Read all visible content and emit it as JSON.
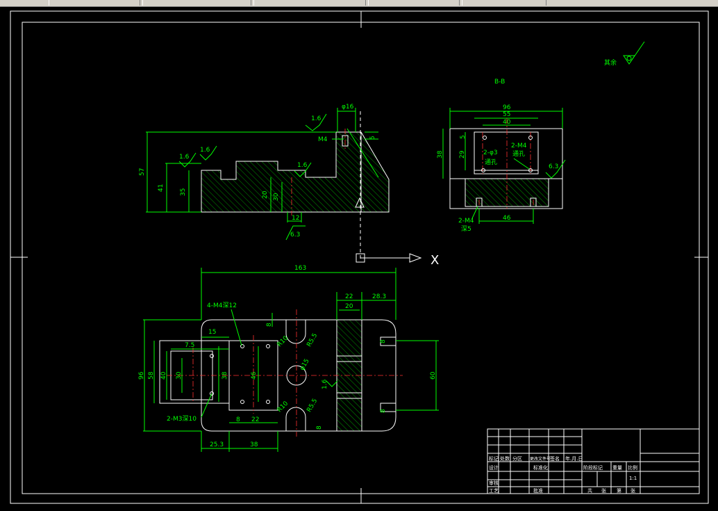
{
  "colors": {
    "background": "#000000",
    "dimension": "#00ff00",
    "outline": "#ffffff",
    "centerline": "#ff3030"
  },
  "section_label": "B-B",
  "roughness_note": "其余",
  "coord_axis_label": "X",
  "front_view": {
    "dims": {
      "d16": "φ16",
      "m4": "M4",
      "r16a": "1.6",
      "r16b": "1.6",
      "r16c": "1.6",
      "r16d": "1.6",
      "h57": "57",
      "h41": "41",
      "h35": "35",
      "h20": "20",
      "h30": "30",
      "w12": "12",
      "r63": "6.3",
      "d5": "5"
    }
  },
  "section_view": {
    "dims": {
      "w96": "96",
      "w55": "55",
      "w40": "40",
      "h38": "38",
      "h29": "29",
      "d5": "5",
      "two_m4_top": "2-M4",
      "thru_a": "通孔",
      "two_d3": "2-φ3",
      "thru_b": "通孔",
      "r63": "6.3",
      "two_m4_bottom": "2-M4",
      "deep_b": "深5",
      "w46": "46"
    }
  },
  "top_view": {
    "dims": {
      "w163": "163",
      "w22": "22",
      "w283": "28.3",
      "w20": "20",
      "four_m4": "4-M4深12",
      "d8a": "8",
      "w15": "15",
      "r10a": "R10",
      "r55a": "R5.5",
      "d15": "φ15",
      "w75": "7.5",
      "h40": "40",
      "h30": "30",
      "h58": "58",
      "h96": "96",
      "h38": "38",
      "h46": "46",
      "h16": "1.6",
      "r10b": "R10",
      "r55b": "R5.5",
      "two_m3": "2-M3深10",
      "d8b": "8",
      "w22b": "22",
      "w8c": "8",
      "w253": "25.3",
      "w38": "38",
      "h60": "60",
      "d8d": "8",
      "d8e": "8"
    }
  },
  "title_block": {
    "r1": [
      "标记",
      "处数",
      "分区",
      "更改文件号",
      "签名",
      "年.月.日"
    ],
    "r2": [
      "设计",
      "",
      "",
      "标准化"
    ],
    "r3": [
      "审核"
    ],
    "r4": [
      "工艺",
      "",
      "",
      "批准"
    ],
    "right_headers": [
      "阶段标记",
      "重量",
      "比例"
    ],
    "scale": "1:1",
    "sheet": [
      "共",
      "张",
      "第",
      "张"
    ]
  }
}
